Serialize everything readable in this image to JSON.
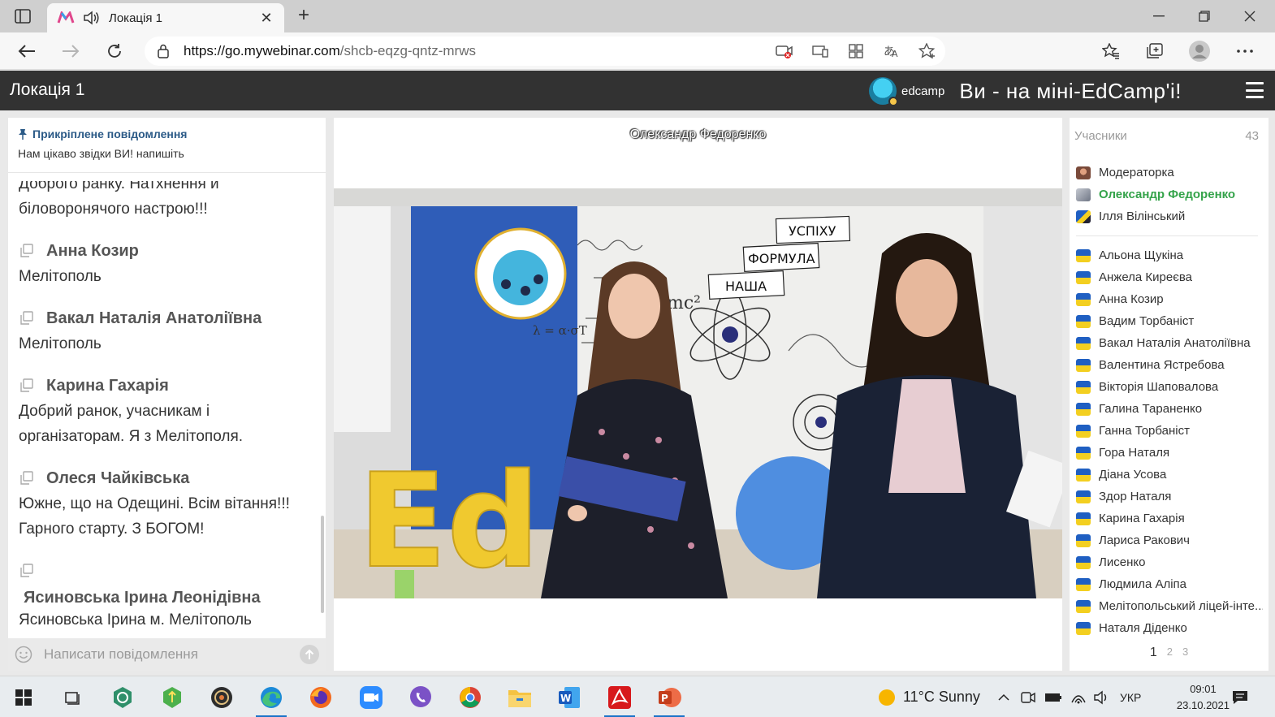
{
  "browser": {
    "tab_title": "Локація 1",
    "url_host": "https://go.mywebinar.com",
    "url_path": "/shcb-eqzg-qntz-mrws"
  },
  "header": {
    "title": "Локація 1",
    "brand_word": "edcamp",
    "slogan": "Ви - на міні-EdCamp'і!"
  },
  "chat": {
    "pinned_label": "Прикріплене повідомлення",
    "pinned_text": "Нам цікаво звідки ВИ! напишіть",
    "partial_line1": "Доброго ранку. Натхнення й",
    "partial_line2": "біловоронячого настрою!!!",
    "messages": [
      {
        "author": "Анна Козир",
        "text": "Мелітополь"
      },
      {
        "author": "Вакал Наталія Анатоліївна",
        "text": "Мелітополь"
      },
      {
        "author": "Карина Гахарія",
        "text": "Добрий ранок, учасникам і організаторам. Я з Мелітополя."
      },
      {
        "author": "Олеся Чайківська",
        "text": "Южне, що на Одещині. Всім вітання!!! Гарного старту. З БОГОМ!"
      },
      {
        "author": "Ясиновська Ірина Леонідівна",
        "text": "Ясиновська Ірина м. Мелітополь"
      }
    ],
    "input_placeholder": "Написати повідомлення"
  },
  "stage": {
    "speaker_name": "Олександр Федоренко",
    "video_words": [
      "УСПІХУ",
      "ФОРМУЛА",
      "НАША"
    ],
    "video_math": [
      "mc²",
      "λ = α·σT",
      "Ed"
    ]
  },
  "participants": {
    "label": "Учасники",
    "count": "43",
    "hosts": [
      {
        "name": "Модераторка"
      },
      {
        "name": "Олександр Федоренко"
      },
      {
        "name": "Ілля Вілінський"
      }
    ],
    "list": [
      "Альона Щукіна",
      "Анжела Киреєва",
      "Анна Козир",
      "Вадим Торбаніст",
      "Вакал Наталія Анатоліївна",
      "Валентина Ястребова",
      "Вікторія Шаповалова",
      "Галина Тараненко",
      "Ганна Торбаніст",
      "Гора Наталя",
      "Діана Усова",
      "Здор Наталя",
      "Карина Гахарія",
      "Лариса Ракович",
      "Лисенко",
      "Людмила Аліпа",
      "Мелітопольський ліцей-інте...",
      "Наталя Діденко"
    ],
    "pages": [
      "1",
      "2",
      "3"
    ]
  },
  "taskbar": {
    "weather": "11°C  Sunny",
    "language": "УКР",
    "time": "09:01",
    "date": "23.10.2021"
  },
  "colors": {
    "appbar": "#323232",
    "speaker_green": "#34a34a",
    "pinned_blue": "#2b5a87",
    "flag_blue": "#1f5fc2",
    "flag_yellow": "#f3cf20"
  }
}
